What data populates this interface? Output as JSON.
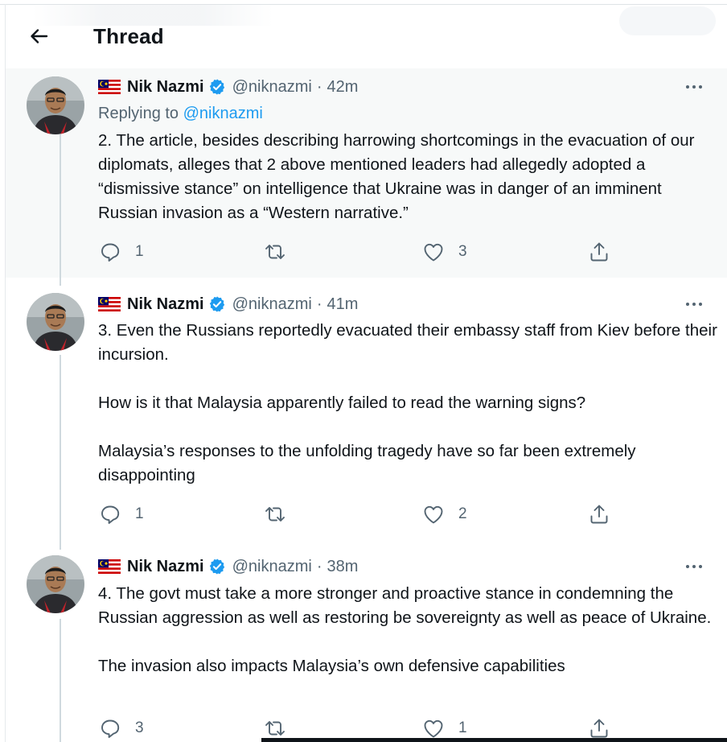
{
  "header": {
    "title": "Thread",
    "back_icon": "arrow-left-icon"
  },
  "author": {
    "name": "Nik Nazmi",
    "handle": "@niknazmi",
    "flag_icon": "malaysia-flag-icon",
    "verified_icon": "verified-badge-icon",
    "verified_color": "#1d9bf0"
  },
  "tweets": [
    {
      "time": "42m",
      "replying_prefix": "Replying to",
      "replying_handle": "@niknazmi",
      "paragraphs": [
        "2. The article, besides describing harrowing shortcomings in the evacuation of our diplomats, alleges that 2 above mentioned leaders had allegedly adopted a “dismissive stance” on intelligence that Ukraine was in danger of an imminent Russian invasion as a “Western narrative.”"
      ],
      "reply_count": "1",
      "retweet_count": "",
      "like_count": "3"
    },
    {
      "time": "41m",
      "paragraphs": [
        "3. Even the Russians reportedly evacuated their embassy staff from Kiev before their incursion.",
        "How is it that Malaysia apparently failed to read the warning signs?",
        "Malaysia’s responses to the unfolding tragedy have so far been extremely disappointing"
      ],
      "reply_count": "1",
      "retweet_count": "",
      "like_count": "2"
    },
    {
      "time": "38m",
      "paragraphs": [
        "4. The govt must take a more stronger and proactive stance in condemning the Russian aggression as well as restoring be sovereignty as well as peace of Ukraine.",
        "The invasion also impacts Malaysia’s own defensive capabilities"
      ],
      "reply_count": "3",
      "retweet_count": "",
      "like_count": "1"
    }
  ],
  "icons": {
    "reply": "reply-icon",
    "retweet": "retweet-icon",
    "like": "heart-icon",
    "share": "share-icon",
    "more": "more-options-icon"
  },
  "colors": {
    "text": "#0f1419",
    "secondary": "#536471",
    "link": "#1d9bf0",
    "highlight_bg": "#f7f9f9"
  }
}
